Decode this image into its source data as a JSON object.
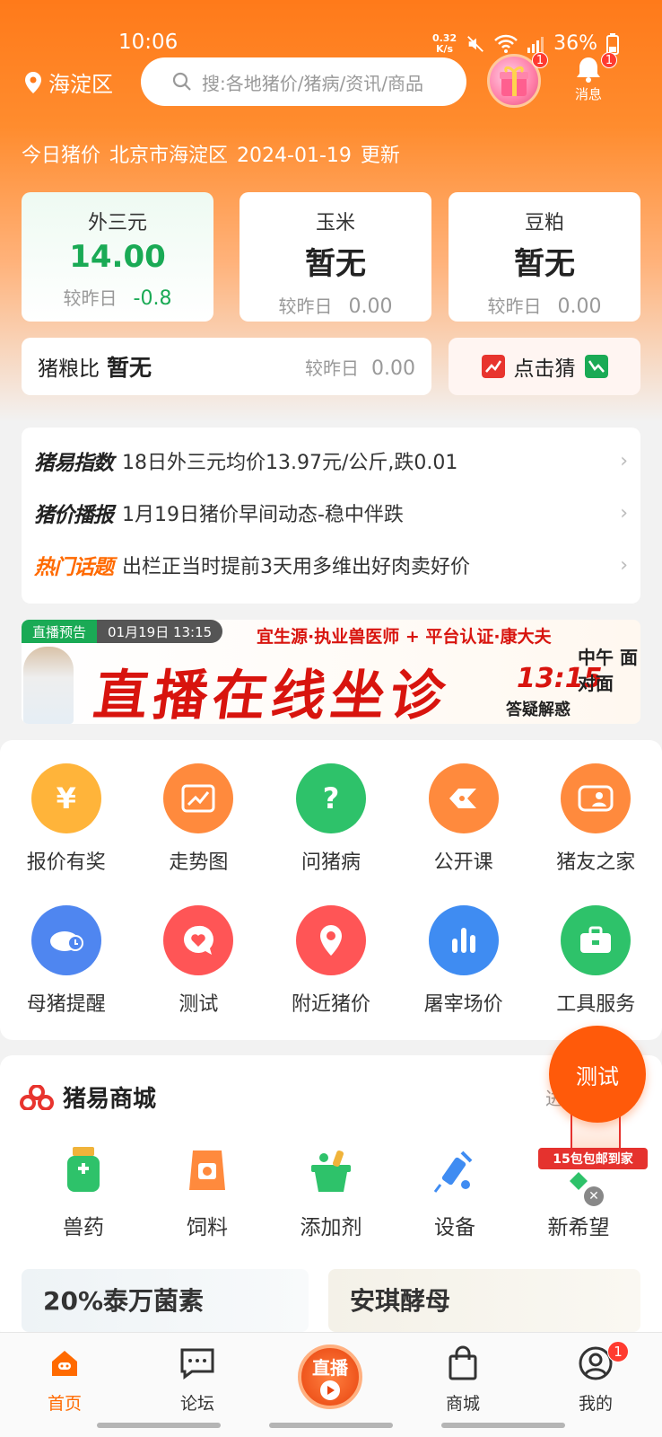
{
  "status_bar": {
    "time": "10:06",
    "net_speed_top": "0.32",
    "net_speed_bottom": "K/s",
    "battery": "36%"
  },
  "header": {
    "location": "海淀区",
    "search_placeholder": "搜:各地猪价/猪病/资讯/商品",
    "gift_badge": "1",
    "message_label": "消息",
    "message_badge": "1"
  },
  "price_header": {
    "label": "今日猪价",
    "region": "北京市海淀区",
    "date": "2024-01-19",
    "suffix": "更新"
  },
  "price_cards": [
    {
      "title": "外三元",
      "value": "14.00",
      "compare_label": "较昨日",
      "change": "-0.8"
    },
    {
      "title": "玉米",
      "value": "暂无",
      "compare_label": "较昨日",
      "change": "0.00"
    },
    {
      "title": "豆粕",
      "value": "暂无",
      "compare_label": "较昨日",
      "change": "0.00"
    }
  ],
  "ratio": {
    "label": "猪粮比",
    "value": "暂无",
    "compare_label": "较昨日",
    "change": "0.00"
  },
  "guess_label": "点击猜",
  "news": [
    {
      "tag": "猪易指数",
      "text": "18日外三元均价13.97元/公斤,跌0.01"
    },
    {
      "tag": "猪价播报",
      "text": "1月19日猪价早间动态-稳中伴跌"
    },
    {
      "tag": "热门话题",
      "text": "出栏正当时提前3天用多维出好肉卖好价"
    }
  ],
  "banner": {
    "tag": "直播预告",
    "datetime": "01月19日 13:15",
    "subtitle": "宜生源·执业兽医师 + 平台认证·康大夫",
    "headline": "直播在线坐诊",
    "time": "13:15",
    "side_top": "中午 面对面",
    "side_bottom": "答疑解惑"
  },
  "grid": [
    {
      "label": "报价有奖",
      "icon": "yen-icon",
      "color": "#ffb43a"
    },
    {
      "label": "走势图",
      "icon": "trend-icon",
      "color": "#ff8a3d"
    },
    {
      "label": "问猪病",
      "icon": "question-icon",
      "color": "#2ec26a"
    },
    {
      "label": "公开课",
      "icon": "class-icon",
      "color": "#ff8a3d"
    },
    {
      "label": "猪友之家",
      "icon": "friends-icon",
      "color": "#ff8a3d"
    },
    {
      "label": "母猪提醒",
      "icon": "sow-reminder-icon",
      "color": "#4f86f0"
    },
    {
      "label": "测试",
      "icon": "heart-chat-icon",
      "color": "#ff5556"
    },
    {
      "label": "附近猪价",
      "icon": "location-pin-icon",
      "color": "#ff5556"
    },
    {
      "label": "屠宰场价",
      "icon": "bar-chart-icon",
      "color": "#3f8cf2"
    },
    {
      "label": "工具服务",
      "icon": "toolbox-icon",
      "color": "#2ec26a"
    }
  ],
  "mall": {
    "title": "猪易商城",
    "enter": "进",
    "items": [
      {
        "label": "兽药",
        "icon": "medicine-bottle-icon"
      },
      {
        "label": "饲料",
        "icon": "feed-bag-icon"
      },
      {
        "label": "添加剂",
        "icon": "basket-icon"
      },
      {
        "label": "设备",
        "icon": "syringe-icon"
      },
      {
        "label": "新希望",
        "icon": "new-hope-icon"
      }
    ],
    "promos": [
      "20%泰万菌素",
      "安琪酵母"
    ]
  },
  "fab_label": "测试",
  "ad_text": "15包包邮到家",
  "tabbar": {
    "tabs": [
      {
        "label": "首页",
        "icon": "home-icon"
      },
      {
        "label": "论坛",
        "icon": "forum-icon"
      },
      {
        "label": "直播",
        "icon": "live-icon"
      },
      {
        "label": "商城",
        "icon": "shop-bag-icon"
      },
      {
        "label": "我的",
        "icon": "profile-icon"
      }
    ],
    "profile_badge": "1"
  },
  "colors": {
    "brand_orange": "#ff7a1a",
    "rise_green": "#1aaa55",
    "active_tab": "#ff6a00"
  }
}
